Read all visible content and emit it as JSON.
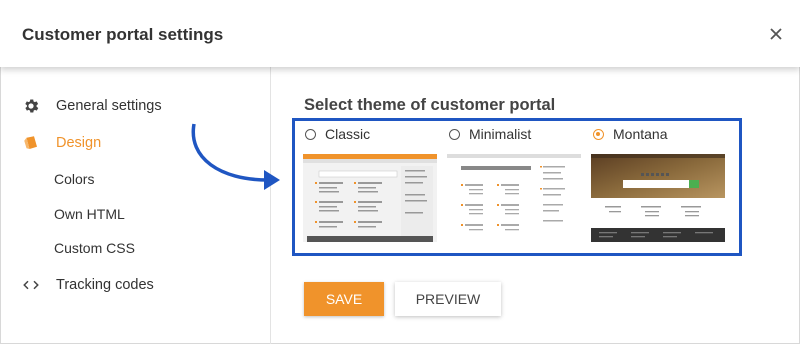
{
  "header": {
    "title": "Customer portal settings",
    "close_icon": "close-icon"
  },
  "sidebar": {
    "items": [
      {
        "label": "General settings",
        "icon": "gear-icon",
        "active": false
      },
      {
        "label": "Design",
        "icon": "brush-icon",
        "active": true
      },
      {
        "label": "Tracking codes",
        "icon": "code-icon",
        "active": false
      }
    ],
    "design_subitems": [
      "Colors",
      "Own HTML",
      "Custom CSS"
    ]
  },
  "main": {
    "title": "Select theme of customer portal",
    "themes": [
      {
        "label": "Classic",
        "selected": false
      },
      {
        "label": "Minimalist",
        "selected": false
      },
      {
        "label": "Montana",
        "selected": true
      }
    ],
    "save_label": "SAVE",
    "preview_label": "PREVIEW"
  },
  "colors": {
    "accent": "#f0932b",
    "highlight": "#1f56c2"
  }
}
